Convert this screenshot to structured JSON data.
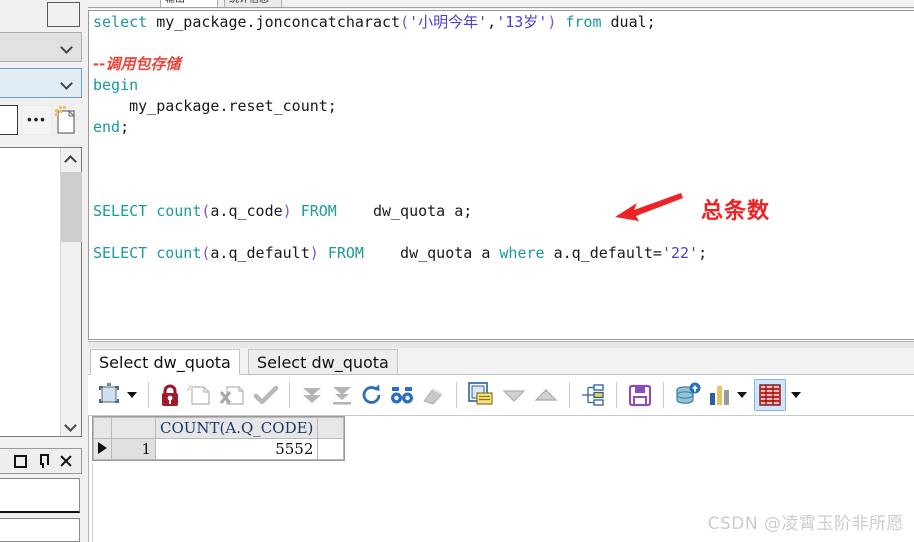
{
  "window": {
    "top_tabs": [
      "输出",
      "统计信息"
    ]
  },
  "sidebar": {
    "combo1_value": "",
    "combo2_value": "",
    "more_button": "•••",
    "buttons": {
      "restore": "restore-window",
      "pin": "pin-window",
      "close": "close-window"
    }
  },
  "editor": {
    "lines": [
      {
        "tokens": [
          {
            "t": "select ",
            "c": "kw"
          },
          {
            "t": "my_package",
            "c": "plain"
          },
          {
            "t": ".",
            "c": "plain"
          },
          {
            "t": "jonconcatcharact",
            "c": "plain"
          },
          {
            "t": "(",
            "c": "punc"
          },
          {
            "t": "'小明今年'",
            "c": "str"
          },
          {
            "t": ",",
            "c": "plain"
          },
          {
            "t": "'13岁'",
            "c": "str"
          },
          {
            "t": ")",
            "c": "punc"
          },
          {
            "t": " ",
            "c": "plain"
          },
          {
            "t": "from",
            "c": "kw"
          },
          {
            "t": " dual",
            "c": "plain"
          },
          {
            "t": ";",
            "c": "plain"
          }
        ]
      },
      {
        "tokens": []
      },
      {
        "tokens": [
          {
            "t": "--调用包存储",
            "c": "cmt"
          }
        ]
      },
      {
        "tokens": [
          {
            "t": "begin",
            "c": "kw"
          }
        ]
      },
      {
        "tokens": [
          {
            "t": "    my_package",
            "c": "plain"
          },
          {
            "t": ".reset_count;",
            "c": "plain"
          }
        ]
      },
      {
        "tokens": [
          {
            "t": "end",
            "c": "kw"
          },
          {
            "t": ";",
            "c": "plain"
          }
        ]
      },
      {
        "tokens": []
      },
      {
        "tokens": []
      },
      {
        "tokens": []
      },
      {
        "tokens": [
          {
            "t": "SELECT ",
            "c": "kw"
          },
          {
            "t": "count",
            "c": "kw"
          },
          {
            "t": "(",
            "c": "punc"
          },
          {
            "t": "a.q_code",
            "c": "plain"
          },
          {
            "t": ")",
            "c": "punc"
          },
          {
            "t": " ",
            "c": "plain"
          },
          {
            "t": "FROM",
            "c": "kw"
          },
          {
            "t": "    dw_quota a;",
            "c": "plain"
          }
        ]
      },
      {
        "tokens": []
      },
      {
        "tokens": [
          {
            "t": "SELECT ",
            "c": "kw"
          },
          {
            "t": "count",
            "c": "kw"
          },
          {
            "t": "(",
            "c": "punc"
          },
          {
            "t": "a.q_default",
            "c": "plain"
          },
          {
            "t": ")",
            "c": "punc"
          },
          {
            "t": " ",
            "c": "plain"
          },
          {
            "t": "FROM",
            "c": "kw"
          },
          {
            "t": "    dw_quota a ",
            "c": "plain"
          },
          {
            "t": "where",
            "c": "kw"
          },
          {
            "t": " a.q_default=",
            "c": "plain"
          },
          {
            "t": "'22'",
            "c": "str"
          },
          {
            "t": ";",
            "c": "plain"
          }
        ]
      }
    ],
    "annotation": {
      "text": "总条数",
      "color": "#ee2222"
    }
  },
  "results": {
    "tabs": [
      {
        "label": "Select dw_quota",
        "active": true
      },
      {
        "label": "Select dw_quota",
        "active": false
      }
    ],
    "toolbar": [
      {
        "name": "select-mode-button",
        "glyph": "select-frame-icon"
      },
      {
        "name": "select-mode-dropdown",
        "glyph": "caret-down-icon"
      },
      {
        "name": "lock-record-button",
        "glyph": "lock-icon"
      },
      {
        "name": "insert-record-button",
        "glyph": "new-record-icon"
      },
      {
        "name": "delete-record-button",
        "glyph": "delete-record-icon"
      },
      {
        "name": "post-changes-button",
        "glyph": "checkmark-icon"
      },
      {
        "name": "fetch-next-page-button",
        "glyph": "double-chevron-down-icon"
      },
      {
        "name": "fetch-last-page-button",
        "glyph": "chevron-down-bar-icon"
      },
      {
        "name": "refresh-button",
        "glyph": "refresh-icon"
      },
      {
        "name": "find-button",
        "glyph": "binoculars-icon"
      },
      {
        "name": "clear-filter-button",
        "glyph": "eraser-icon"
      },
      {
        "name": "single-record-view-button",
        "glyph": "record-form-icon"
      },
      {
        "name": "sort-descending-button",
        "glyph": "triangle-down-icon"
      },
      {
        "name": "sort-ascending-button",
        "glyph": "triangle-up-icon"
      },
      {
        "name": "query-plan-button",
        "glyph": "tree-nodes-icon"
      },
      {
        "name": "export-save-button",
        "glyph": "floppy-disk-icon"
      },
      {
        "name": "copy-to-database-button",
        "glyph": "database-upload-icon"
      },
      {
        "name": "chart-button",
        "glyph": "bar-chart-icon"
      },
      {
        "name": "chart-dropdown",
        "glyph": "caret-down-icon"
      },
      {
        "name": "grid-view-button",
        "glyph": "grid-table-icon"
      },
      {
        "name": "grid-view-dropdown",
        "glyph": "caret-down-icon"
      }
    ],
    "grid": {
      "columns": [
        "COUNT(A.Q_CODE)"
      ],
      "rows": [
        {
          "num": "1",
          "values": [
            "5552"
          ]
        }
      ]
    }
  },
  "watermark": "CSDN @凌霄玉阶非所愿"
}
